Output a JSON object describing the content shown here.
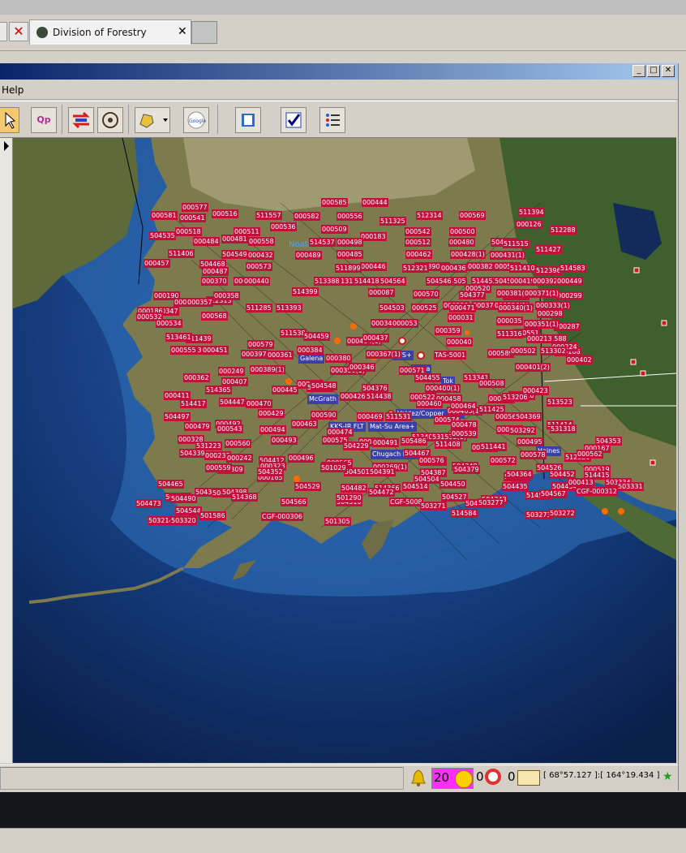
{
  "browser": {
    "tab_title": "Division of Forestry",
    "tab_close": "✕",
    "left_close": "✕"
  },
  "app": {
    "menu_help": "Help",
    "window_buttons": [
      "_",
      "□",
      "✕"
    ],
    "toolbar": {
      "select": "",
      "qp": "Qp",
      "swap": "",
      "target": "",
      "map_tool": "",
      "google": "Google",
      "book": "",
      "check": "",
      "list": ""
    }
  },
  "map": {
    "places": [
      {
        "label": "AFS+"
      },
      {
        "label": "Galena"
      },
      {
        "label": "Delta"
      },
      {
        "label": "Tok"
      },
      {
        "label": "McGrath"
      },
      {
        "label": "Valdez/Copper River"
      },
      {
        "label": "Mat-Su Area+"
      },
      {
        "label": "KKS-IR FLT"
      },
      {
        "label": "Chugach NF+"
      },
      {
        "label": "Haines"
      },
      {
        "label": "TAS-5001"
      }
    ],
    "fires": [
      "000577",
      "000581",
      "000541",
      "000516",
      "000518",
      "504535",
      "000484",
      "000511",
      "000481",
      "000558",
      "511557",
      "000536",
      "000582",
      "000585",
      "000444",
      "000556",
      "000509",
      "511325",
      "512314",
      "000569",
      "511394",
      "000126",
      "512288",
      "000500",
      "000542",
      "000512",
      "000480",
      "504552",
      "511515",
      "511427",
      "000183",
      "514537",
      "000498",
      "000485",
      "000462",
      "000428(1)",
      "000431(1)",
      "000457",
      "511406",
      "504549",
      "504468",
      "000432",
      "000489",
      "000446",
      "000390(1)",
      "000436",
      "000382",
      "000545",
      "511410",
      "512396",
      "514583",
      "000487",
      "000430",
      "000370",
      "000573",
      "511899",
      "512321",
      "514505",
      "514453",
      "504521",
      "000554",
      "000419(1)",
      "000392(1)",
      "000449",
      "000299",
      "000190",
      "000199",
      "512313",
      "514399",
      "513155",
      "504448",
      "000570",
      "000520",
      "000381(1)",
      "000371(1)",
      "000347",
      "000357",
      "000358",
      "000440",
      "513388",
      "514418",
      "504564",
      "504546",
      "504377",
      "000530",
      "000374",
      "000336(1)",
      "000333(1)",
      "000287",
      "000186",
      "000568",
      "511285",
      "513393",
      "000087",
      "504503",
      "000525",
      "000471",
      "000340(1)",
      "000351(1)",
      "000298",
      "000532",
      "000534",
      "511439",
      "511538",
      "504459",
      "000404(1)",
      "000437",
      "000359",
      "000342(1)",
      "000053",
      "000031",
      "000035",
      "000551",
      "511588",
      "000166",
      "513461",
      "504563",
      "000579",
      "000384",
      "000367(1)",
      "000040",
      "511316",
      "000213",
      "000224",
      "000555",
      "000451",
      "000397",
      "000361",
      "000380",
      "000589",
      "000502",
      "513302",
      "000402",
      "000249",
      "000389(1)",
      "000350(1)",
      "000346",
      "000571",
      "504455",
      "513341",
      "000508",
      "000401(2)",
      "000362",
      "000407",
      "000416",
      "513268",
      "504548",
      "504376",
      "000400(1)",
      "000476",
      "000411",
      "514365",
      "000445",
      "000426",
      "514438",
      "000522",
      "000458",
      "000405(1)",
      "501310",
      "000423",
      "513206",
      "513523",
      "514417",
      "504447",
      "000470",
      "000460",
      "000464",
      "511425",
      "504497",
      "000492",
      "000429",
      "000463",
      "000469",
      "000590",
      "511531",
      "000574",
      "000478",
      "000561",
      "504369",
      "000479",
      "000543",
      "000494",
      "000474",
      "000580",
      "513403",
      "531532(1)",
      "000539",
      "000483",
      "503292",
      "511414",
      "000328",
      "531223",
      "000560",
      "000493",
      "000575",
      "504229",
      "000491",
      "505486",
      "511408",
      "000533",
      "000495",
      "531318",
      "000167",
      "504339",
      "000233",
      "000496",
      "504467",
      "501282",
      "511441",
      "000578",
      "512220",
      "000562",
      "000519",
      "504353",
      "000242",
      "504412",
      "000565",
      "511524",
      "000269(1)",
      "000576",
      "504348",
      "000572",
      "514415",
      "501309",
      "000559",
      "000165",
      "000323",
      "504501",
      "504391",
      "504387",
      "504379",
      "504378",
      "504364",
      "504526",
      "504465",
      "504356",
      "504499",
      "504352",
      "501029",
      "514366",
      "504504",
      "504450",
      "504435",
      "504434",
      "504452",
      "000413",
      "504547",
      "504490",
      "504398",
      "514368",
      "504566",
      "504529",
      "504482",
      "504510",
      "504472",
      "504514",
      "504527",
      "504343",
      "504553",
      "514540",
      "504567",
      "504473",
      "504544",
      "501586",
      "CGF-000306",
      "501305",
      "501290",
      "CGF-5008",
      "503271",
      "514584",
      "503277",
      "503273",
      "503272",
      "CGF-000312",
      "503334",
      "503331",
      "503214",
      "503320"
    ]
  },
  "status": {
    "count": "20",
    "zero1": "0",
    "zero2": "0",
    "coords": "[ 68°57.127 ]:[ 164°19.434 ]"
  }
}
